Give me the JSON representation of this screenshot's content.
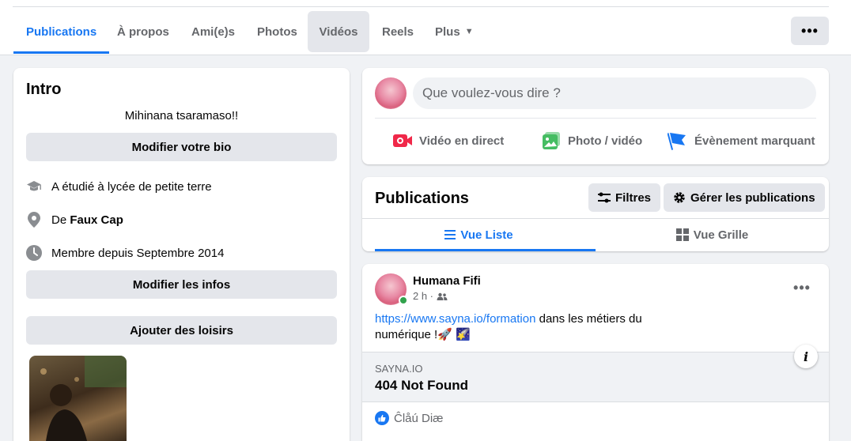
{
  "tabs": [
    {
      "label": "Publications",
      "active": true
    },
    {
      "label": "À propos"
    },
    {
      "label": "Ami(e)s"
    },
    {
      "label": "Photos"
    },
    {
      "label": "Vidéos",
      "hover": true
    },
    {
      "label": "Reels"
    },
    {
      "label": "Plus"
    }
  ],
  "more_label": "•••",
  "intro": {
    "title": "Intro",
    "bio": "Mihinana tsaramaso!!",
    "edit_bio": "Modifier votre bio",
    "studied": "A étudié à lycée de petite terre",
    "from_prefix": "De",
    "from_place": "Faux Cap",
    "member_since": "Membre depuis Septembre 2014",
    "edit_info": "Modifier les infos",
    "add_hobbies": "Ajouter des loisirs"
  },
  "composer": {
    "placeholder": "Que voulez-vous dire ?",
    "live": "Vidéo en direct",
    "photo": "Photo / vidéo",
    "event": "Évènement marquant"
  },
  "publications": {
    "title": "Publications",
    "filters": "Filtres",
    "manage": "Gérer les publications",
    "list_view": "Vue Liste",
    "grid_view": "Vue Grille"
  },
  "post": {
    "author": "Humana Fifi",
    "time": "2 h ·",
    "link": "https://www.sayna.io/formation",
    "text_after_link": " dans les métiers du numérique !🚀 🌠",
    "dots": "•••",
    "preview_domain": "SAYNA.IO",
    "preview_title": "404 Not Found",
    "reaction_names": "Ĉlåú Diæ"
  },
  "colors": {
    "accent": "#1877f2",
    "live_red": "#f02849",
    "photo_green": "#45bd62",
    "event_blue": "#1877f2"
  }
}
